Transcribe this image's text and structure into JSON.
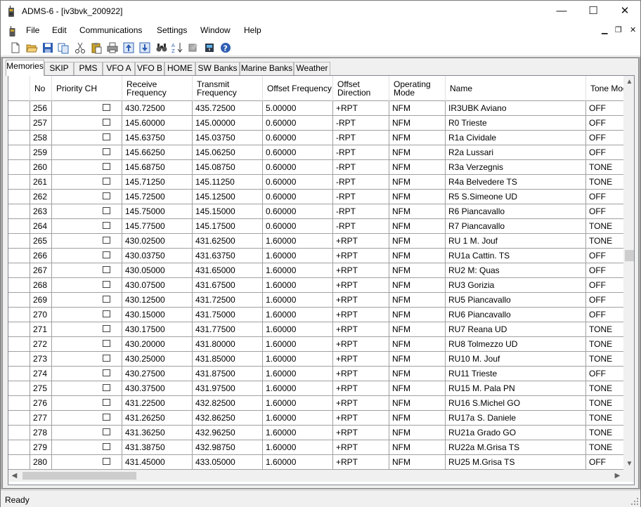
{
  "window": {
    "title": "ADMS-6 - [iv3bvk_200922]",
    "minimize": "—",
    "maximize": "☐",
    "close": "✕"
  },
  "menu": {
    "items": [
      "File",
      "Edit",
      "Communications",
      "Settings",
      "Window",
      "Help"
    ],
    "mdi_min": "▁",
    "mdi_restore": "❐",
    "mdi_close": "✕"
  },
  "toolbar": {
    "buttons": [
      "new-icon",
      "open-icon",
      "save-icon",
      "copy-icon",
      "cut-icon",
      "paste-icon",
      "print-icon",
      "upload-icon",
      "download-icon",
      "find-icon",
      "sort-icon",
      "tool-icon",
      "radio-icon",
      "help-icon"
    ]
  },
  "tabs": [
    "Memories",
    "SKIP",
    "PMS",
    "VFO A",
    "VFO B",
    "HOME",
    "SW Banks",
    "Marine Banks",
    "Weather"
  ],
  "active_tab": "Memories",
  "table": {
    "headers": {
      "no": "No",
      "priority": "Priority CH",
      "rx_1": "Receive",
      "rx_2": "Frequency",
      "tx_1": "Transmit",
      "tx_2": "Frequency",
      "offset": "Offset Frequency",
      "dir_1": "Offset",
      "dir_2": "Direction",
      "mode_1": "Operating",
      "mode_2": "Mode",
      "name": "Name",
      "tone": "Tone Mode"
    },
    "rows": [
      {
        "no": "256",
        "rx": "430.72500",
        "tx": "435.72500",
        "offset": "5.00000",
        "dir": "+RPT",
        "mode": "NFM",
        "name": "IR3UBK Aviano",
        "tone": "OFF"
      },
      {
        "no": "257",
        "rx": "145.60000",
        "tx": "145.00000",
        "offset": "0.60000",
        "dir": "-RPT",
        "mode": "NFM",
        "name": "R0 Trieste",
        "tone": "OFF"
      },
      {
        "no": "258",
        "rx": "145.63750",
        "tx": "145.03750",
        "offset": "0.60000",
        "dir": "-RPT",
        "mode": "NFM",
        "name": "R1a Cividale",
        "tone": "OFF"
      },
      {
        "no": "259",
        "rx": "145.66250",
        "tx": "145.06250",
        "offset": "0.60000",
        "dir": "-RPT",
        "mode": "NFM",
        "name": "R2a Lussari",
        "tone": "OFF"
      },
      {
        "no": "260",
        "rx": "145.68750",
        "tx": "145.08750",
        "offset": "0.60000",
        "dir": "-RPT",
        "mode": "NFM",
        "name": "R3a Verzegnis",
        "tone": "TONE"
      },
      {
        "no": "261",
        "rx": "145.71250",
        "tx": "145.11250",
        "offset": "0.60000",
        "dir": "-RPT",
        "mode": "NFM",
        "name": "R4a Belvedere TS",
        "tone": "TONE"
      },
      {
        "no": "262",
        "rx": "145.72500",
        "tx": "145.12500",
        "offset": "0.60000",
        "dir": "-RPT",
        "mode": "NFM",
        "name": "R5 S.Simeone UD",
        "tone": "OFF"
      },
      {
        "no": "263",
        "rx": "145.75000",
        "tx": "145.15000",
        "offset": "0.60000",
        "dir": "-RPT",
        "mode": "NFM",
        "name": "R6 Piancavallo",
        "tone": "OFF"
      },
      {
        "no": "264",
        "rx": "145.77500",
        "tx": "145.17500",
        "offset": "0.60000",
        "dir": "-RPT",
        "mode": "NFM",
        "name": "R7 Piancavallo",
        "tone": "TONE"
      },
      {
        "no": "265",
        "rx": "430.02500",
        "tx": "431.62500",
        "offset": "1.60000",
        "dir": "+RPT",
        "mode": "NFM",
        "name": "RU 1 M. Jouf",
        "tone": "TONE"
      },
      {
        "no": "266",
        "rx": "430.03750",
        "tx": "431.63750",
        "offset": "1.60000",
        "dir": "+RPT",
        "mode": "NFM",
        "name": "RU1a Cattin. TS",
        "tone": "OFF"
      },
      {
        "no": "267",
        "rx": "430.05000",
        "tx": "431.65000",
        "offset": "1.60000",
        "dir": "+RPT",
        "mode": "NFM",
        "name": "RU2 M: Quas",
        "tone": "OFF"
      },
      {
        "no": "268",
        "rx": "430.07500",
        "tx": "431.67500",
        "offset": "1.60000",
        "dir": "+RPT",
        "mode": "NFM",
        "name": "RU3 Gorizia",
        "tone": "OFF"
      },
      {
        "no": "269",
        "rx": "430.12500",
        "tx": "431.72500",
        "offset": "1.60000",
        "dir": "+RPT",
        "mode": "NFM",
        "name": "RU5 Piancavallo",
        "tone": "OFF"
      },
      {
        "no": "270",
        "rx": "430.15000",
        "tx": "431.75000",
        "offset": "1.60000",
        "dir": "+RPT",
        "mode": "NFM",
        "name": "RU6 Piancavallo",
        "tone": "OFF"
      },
      {
        "no": "271",
        "rx": "430.17500",
        "tx": "431.77500",
        "offset": "1.60000",
        "dir": "+RPT",
        "mode": "NFM",
        "name": "RU7 Reana UD",
        "tone": "TONE"
      },
      {
        "no": "272",
        "rx": "430.20000",
        "tx": "431.80000",
        "offset": "1.60000",
        "dir": "+RPT",
        "mode": "NFM",
        "name": "RU8 Tolmezzo UD",
        "tone": "TONE"
      },
      {
        "no": "273",
        "rx": "430.25000",
        "tx": "431.85000",
        "offset": "1.60000",
        "dir": "+RPT",
        "mode": "NFM",
        "name": "RU10 M. Jouf",
        "tone": "TONE"
      },
      {
        "no": "274",
        "rx": "430.27500",
        "tx": "431.87500",
        "offset": "1.60000",
        "dir": "+RPT",
        "mode": "NFM",
        "name": "RU11 Trieste",
        "tone": "OFF"
      },
      {
        "no": "275",
        "rx": "430.37500",
        "tx": "431.97500",
        "offset": "1.60000",
        "dir": "+RPT",
        "mode": "NFM",
        "name": "RU15 M. Pala PN",
        "tone": "TONE"
      },
      {
        "no": "276",
        "rx": "431.22500",
        "tx": "432.82500",
        "offset": "1.60000",
        "dir": "+RPT",
        "mode": "NFM",
        "name": "RU16 S.Michel GO",
        "tone": "TONE"
      },
      {
        "no": "277",
        "rx": "431.26250",
        "tx": "432.86250",
        "offset": "1.60000",
        "dir": "+RPT",
        "mode": "NFM",
        "name": "RU17a S. Daniele",
        "tone": "TONE"
      },
      {
        "no": "278",
        "rx": "431.36250",
        "tx": "432.96250",
        "offset": "1.60000",
        "dir": "+RPT",
        "mode": "NFM",
        "name": "RU21a Grado GO",
        "tone": "TONE"
      },
      {
        "no": "279",
        "rx": "431.38750",
        "tx": "432.98750",
        "offset": "1.60000",
        "dir": "+RPT",
        "mode": "NFM",
        "name": "RU22a M.Grisa TS",
        "tone": "TONE"
      },
      {
        "no": "280",
        "rx": "431.45000",
        "tx": "433.05000",
        "offset": "1.60000",
        "dir": "+RPT",
        "mode": "NFM",
        "name": "RU25 M.Grisa TS",
        "tone": "OFF"
      }
    ]
  },
  "scroll": {
    "up": "▲",
    "down": "▼",
    "left": "◀",
    "right": "▶"
  },
  "status": {
    "text": "Ready"
  }
}
